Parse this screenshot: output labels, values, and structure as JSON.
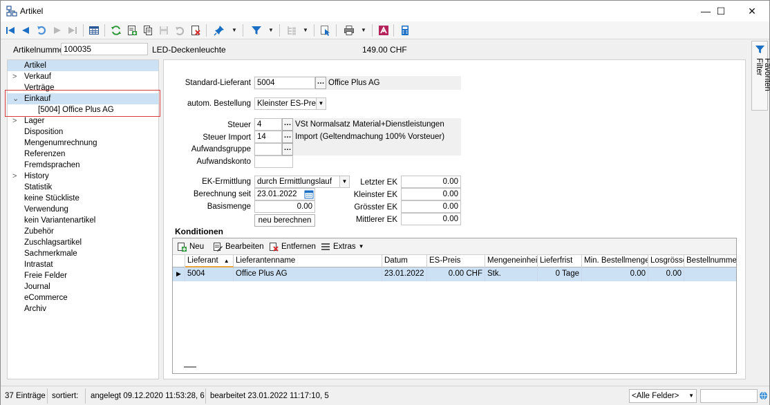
{
  "window": {
    "title": "Artikel",
    "controls": {
      "minimize": "—",
      "maximize": "☐",
      "close": "✕"
    }
  },
  "toolbar": {
    "icons": [
      "first-record-icon",
      "previous-record-icon",
      "back-icon",
      "next-record-icon",
      "last-record-icon",
      "table-view-icon",
      "refresh-icon",
      "new-record-icon",
      "copy-record-icon",
      "save-icon",
      "undo-icon",
      "delete-record-icon",
      "pin-icon",
      "filter-icon",
      "tree-icon",
      "cursor-select-icon",
      "print-icon",
      "export-icon",
      "calculator-icon"
    ]
  },
  "header": {
    "article_number_label": "Artikelnummer",
    "article_number": "100035",
    "description": "LED-Deckenleuchte",
    "price": "149.00  CHF"
  },
  "tree": {
    "items": [
      {
        "label": "Artikel",
        "selected": true,
        "expander": ""
      },
      {
        "label": "Verkauf",
        "expander": ">"
      },
      {
        "label": "Verträge",
        "expander": ""
      },
      {
        "label": "Einkauf",
        "expander": "v"
      },
      {
        "label": "[5004]  Office Plus AG",
        "child": true
      },
      {
        "label": "Lager",
        "expander": ">"
      },
      {
        "label": "Disposition"
      },
      {
        "label": "Mengenumrechnung"
      },
      {
        "label": "Referenzen"
      },
      {
        "label": "Fremdsprachen"
      },
      {
        "label": "History",
        "expander": ">"
      },
      {
        "label": "Statistik"
      },
      {
        "label": "keine Stückliste"
      },
      {
        "label": "Verwendung"
      },
      {
        "label": "kein Variantenartikel"
      },
      {
        "label": "Zubehör"
      },
      {
        "label": "Zuschlagsartikel"
      },
      {
        "label": "Sachmerkmale"
      },
      {
        "label": "Intrastat"
      },
      {
        "label": "Freie Felder"
      },
      {
        "label": "Journal"
      },
      {
        "label": "eCommerce"
      },
      {
        "label": "Archiv"
      }
    ]
  },
  "form": {
    "supplier_label": "Standard-Lieferant",
    "supplier_value": "5004",
    "supplier_name": "Office Plus AG",
    "auto_order_label": "autom. Bestellung",
    "auto_order_value": "Kleinster ES-Preis",
    "tax_label": "Steuer",
    "tax_value": "4",
    "tax_desc": "VSt Normalsatz Material+Dienstleistungen",
    "tax_import_label": "Steuer Import",
    "tax_import_value": "14",
    "tax_import_desc": "Import (Geltendmachung 100% Vorsteuer)",
    "expense_group_label": "Aufwandsgruppe",
    "expense_group_value": "",
    "expense_account_label": "Aufwandskonto",
    "expense_account_value": "",
    "ek_method_label": "EK-Ermittlung",
    "ek_method_value": "durch Ermittlungslauf",
    "calc_since_label": "Berechnung seit",
    "calc_since_value": "23.01.2022",
    "base_qty_label": "Basismenge",
    "base_qty_value": "0.00",
    "recalc_button": "neu berechnen",
    "last_ek_label": "Letzter EK",
    "last_ek_value": "0.00",
    "min_ek_label": "Kleinster EK",
    "min_ek_value": "0.00",
    "max_ek_label": "Grösster EK",
    "max_ek_value": "0.00",
    "avg_ek_label": "Mittlerer EK",
    "avg_ek_value": "0.00"
  },
  "conditions": {
    "title": "Konditionen",
    "toolbar": {
      "new": "Neu",
      "edit": "Bearbeiten",
      "remove": "Entfernen",
      "extras": "Extras"
    },
    "columns": [
      "Lieferant",
      "Lieferantenname",
      "Datum",
      "ES-Preis",
      "Mengeneinheit",
      "Lieferfrist",
      "Min. Bestellmenge",
      "Losgrösse",
      "Bestellnummer"
    ],
    "rows": [
      [
        "5004",
        "Office Plus AG",
        "23.01.2022",
        "0.00 CHF",
        "Stk.",
        "0 Tage",
        "0.00",
        "0.00",
        ""
      ]
    ]
  },
  "sidetab": {
    "label": "Favoriten Filter"
  },
  "status": {
    "entries": "37 Einträge",
    "sorted": "sortiert:",
    "created": "angelegt 09.12.2020 11:53:28,  6",
    "edited": "bearbeitet 23.01.2022 11:17:10,  5",
    "field_filter": "<Alle Felder>",
    "search_value": ""
  },
  "colors": {
    "selection": "#cde1f5",
    "accent": "#1a6fc4",
    "highlight_border": "#d83b3b"
  }
}
